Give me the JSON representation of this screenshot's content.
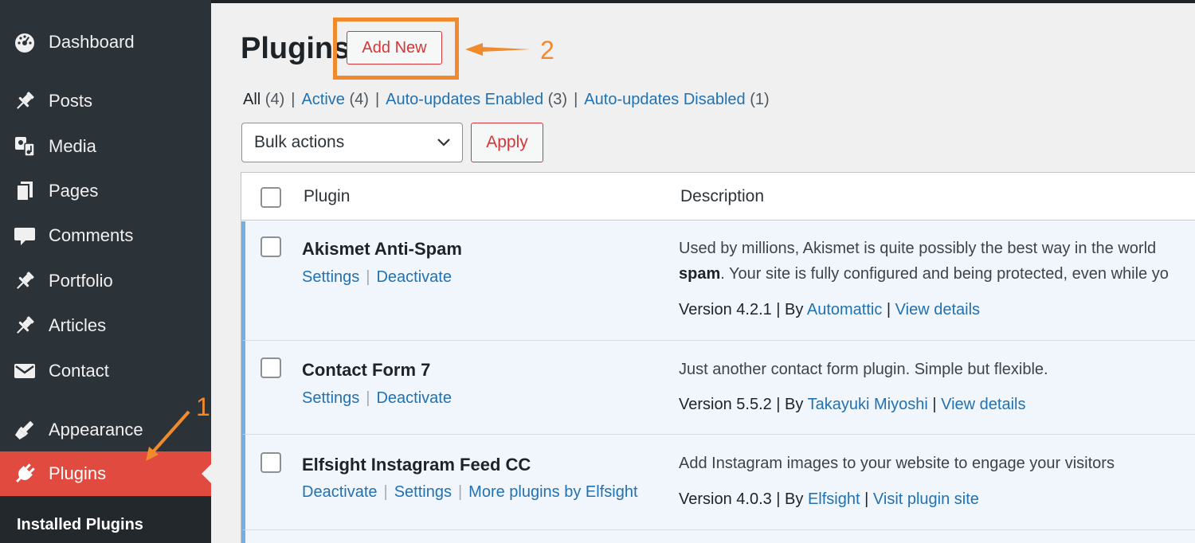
{
  "sidebar": {
    "items": [
      {
        "label": "Dashboard",
        "icon": "dashboard-icon"
      },
      {
        "label": "Posts",
        "icon": "pin-icon"
      },
      {
        "label": "Media",
        "icon": "media-icon"
      },
      {
        "label": "Pages",
        "icon": "pages-icon"
      },
      {
        "label": "Comments",
        "icon": "comment-icon"
      },
      {
        "label": "Portfolio",
        "icon": "pin-icon"
      },
      {
        "label": "Articles",
        "icon": "pin-icon"
      },
      {
        "label": "Contact",
        "icon": "envelope-icon"
      },
      {
        "label": "Appearance",
        "icon": "brush-icon"
      },
      {
        "label": "Plugins",
        "icon": "plugin-icon"
      }
    ],
    "current": "Plugins",
    "submenu": {
      "label": "Installed Plugins"
    }
  },
  "header": {
    "title": "Plugins",
    "add_new_label": "Add New"
  },
  "annotations": {
    "step1": "1",
    "step2": "2"
  },
  "filters": {
    "all": {
      "label": "All",
      "count": "(4)"
    },
    "active": {
      "label": "Active",
      "count": "(4)"
    },
    "auto_enabled": {
      "label": "Auto-updates Enabled",
      "count": "(3)"
    },
    "auto_disabled": {
      "label": "Auto-updates Disabled",
      "count": "(1)"
    },
    "separator": "|"
  },
  "bulk": {
    "selected": "Bulk actions",
    "apply_label": "Apply"
  },
  "table": {
    "col_plugin": "Plugin",
    "col_description": "Description",
    "rows": [
      {
        "name": "Akismet Anti-Spam",
        "action1": "Settings",
        "action2": "Deactivate",
        "desc_line1": "Used by millions, Akismet is quite possibly the best way in the world",
        "desc_line2_bold": "spam",
        "desc_line2_rest": ". Your site is fully configured and being protected, even while yo",
        "version": "Version 4.2.1 | By",
        "author": "Automattic",
        "sep": "|",
        "link": "View details"
      },
      {
        "name": "Contact Form 7",
        "action1": "Settings",
        "action2": "Deactivate",
        "desc_line1": "Just another contact form plugin. Simple but flexible.",
        "version": "Version 5.5.2 | By",
        "author": "Takayuki Miyoshi",
        "sep": "|",
        "link": "View details"
      },
      {
        "name": "Elfsight Instagram Feed CC",
        "action1": "Deactivate",
        "action2": "Settings",
        "action3": "More plugins by Elfsight",
        "desc_line1": "Add Instagram images to your website to engage your visitors",
        "version": "Version 4.0.3 | By",
        "author": "Elfsight",
        "sep": "|",
        "link": "Visit plugin site"
      }
    ]
  },
  "colors": {
    "sidebar_bg": "#2c3338",
    "current_bg": "#e04a3f",
    "link": "#2271b1",
    "annotation": "#f08a2c",
    "active_row": "#f0f6fc"
  }
}
